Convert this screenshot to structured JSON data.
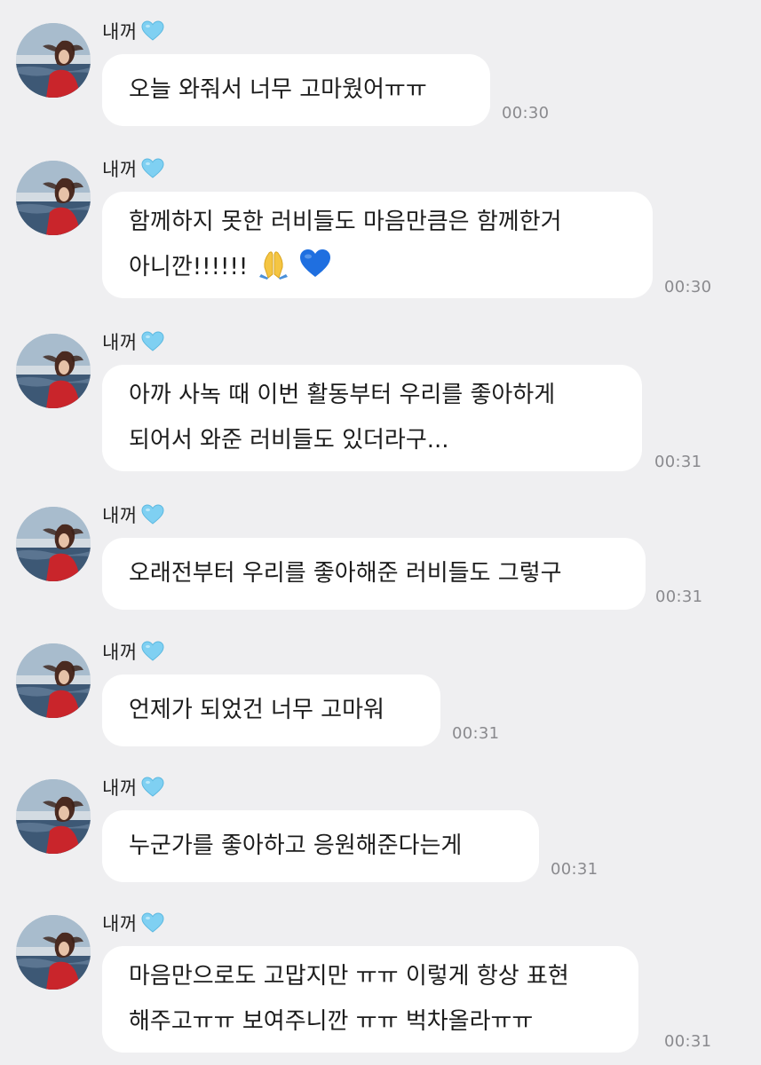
{
  "chat": {
    "sender_name": "내꺼",
    "name_icon": "light-blue-heart-icon",
    "messages": [
      {
        "lines": [
          "오늘 와줘서 너무 고마웠어ㅠㅠ"
        ],
        "time": "00:30"
      },
      {
        "lines": [
          "함께하지 못한 러비들도 마음만큼은 함께한거",
          "아니깐!!!!!!"
        ],
        "emojis": [
          "folded-hands-icon",
          "blue-heart-icon"
        ],
        "time": "00:30"
      },
      {
        "lines": [
          "아까 사녹 때 이번 활동부터 우리를 좋아하게",
          "되어서 와준 러비들도 있더라구..."
        ],
        "time": "00:31"
      },
      {
        "lines": [
          "오래전부터 우리를 좋아해준 러비들도 그렇구"
        ],
        "time": "00:31"
      },
      {
        "lines": [
          "언제가 되었건 너무 고마워"
        ],
        "time": "00:31"
      },
      {
        "lines": [
          "누군가를 좋아하고 응원해준다는게"
        ],
        "time": "00:31"
      },
      {
        "lines": [
          "마음만으로도 고맙지만 ㅠㅠ 이렇게 항상 표현",
          "해주고ㅠㅠ 보여주니깐 ㅠㅠ 벅차올라ㅠㅠ"
        ],
        "time": "00:31"
      }
    ]
  },
  "colors": {
    "background": "#efeff1",
    "bubble": "#ffffff",
    "heart": "#7fd0f2",
    "timestamp": "#8a8a8e"
  }
}
